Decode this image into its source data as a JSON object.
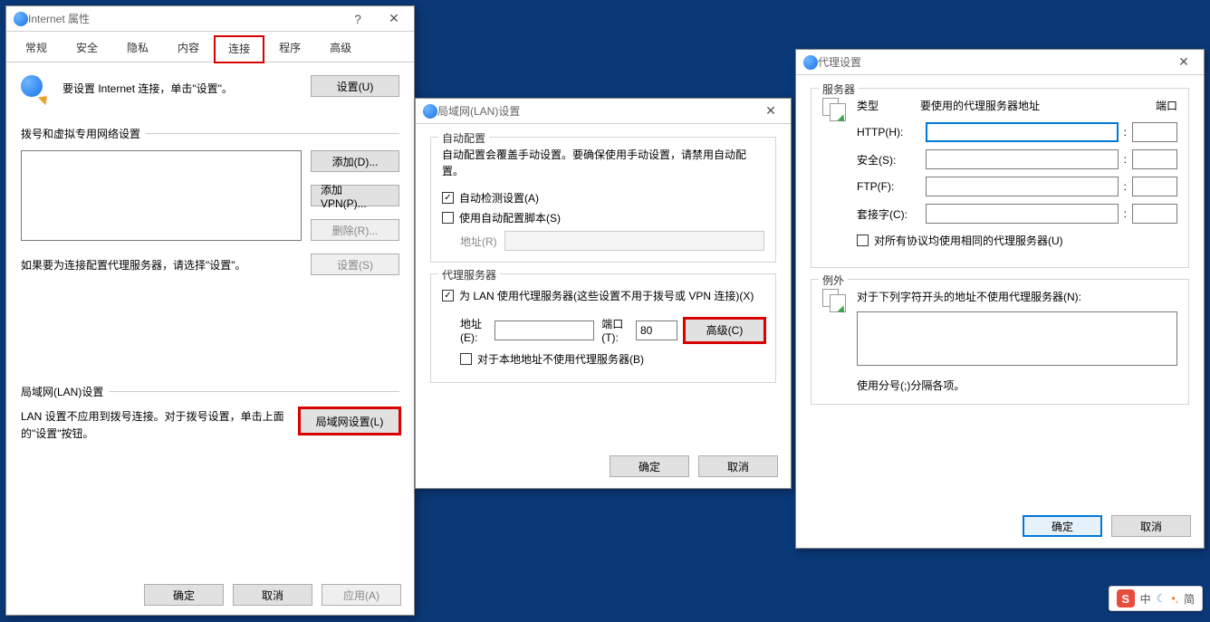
{
  "window1": {
    "title": "Internet 属性",
    "tabs": [
      "常规",
      "安全",
      "隐私",
      "内容",
      "连接",
      "程序",
      "高级"
    ],
    "active_tab_index": 4,
    "setup_text": "要设置 Internet 连接，单击\"设置\"。",
    "setup_btn": "设置(U)",
    "dialup_label": "拨号和虚拟专用网络设置",
    "add_btn": "添加(D)...",
    "add_vpn_btn": "添加 VPN(P)...",
    "remove_btn": "删除(R)...",
    "note": "如果要为连接配置代理服务器，请选择\"设置\"。",
    "settings_btn": "设置(S)",
    "lan_label": "局域网(LAN)设置",
    "lan_note": "LAN 设置不应用到拨号连接。对于拨号设置，单击上面的\"设置\"按钮。",
    "lan_btn": "局域网设置(L)",
    "ok": "确定",
    "cancel": "取消",
    "apply": "应用(A)"
  },
  "window2": {
    "title": "局域网(LAN)设置",
    "auto_legend": "自动配置",
    "auto_note": "自动配置会覆盖手动设置。要确保使用手动设置，请禁用自动配置。",
    "auto_detect": "自动检测设置(A)",
    "auto_script": "使用自动配置脚本(S)",
    "address_label": "地址(R)",
    "proxy_legend": "代理服务器",
    "proxy_use": "为 LAN 使用代理服务器(这些设置不用于拨号或 VPN 连接)(X)",
    "addr_label": "地址(E):",
    "port_label": "端口(T):",
    "port_value": "80",
    "advanced_btn": "高级(C)",
    "bypass_local": "对于本地地址不使用代理服务器(B)",
    "ok": "确定",
    "cancel": "取消"
  },
  "window3": {
    "title": "代理设置",
    "server_legend": "服务器",
    "type_label": "类型",
    "addr_label": "要使用的代理服务器地址",
    "port_label": "端口",
    "rows": [
      {
        "label": "HTTP(H):"
      },
      {
        "label": "安全(S):"
      },
      {
        "label": "FTP(F):"
      },
      {
        "label": "套接字(C):"
      }
    ],
    "same_all": "对所有协议均使用相同的代理服务器(U)",
    "except_legend": "例外",
    "except_note": "对于下列字符开头的地址不使用代理服务器(N):",
    "except_hint": "使用分号(;)分隔各项。",
    "ok": "确定",
    "cancel": "取消"
  },
  "ime": {
    "cn": "中",
    "simp": "简"
  }
}
